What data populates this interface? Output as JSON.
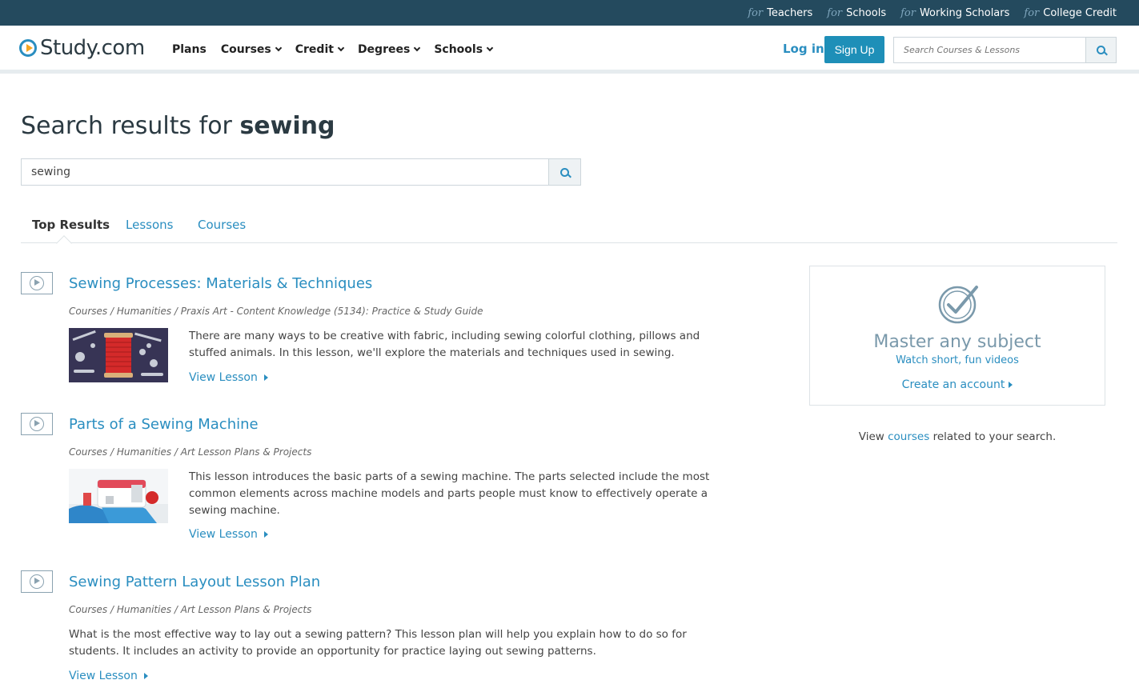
{
  "topbar": {
    "prefix": "for",
    "links": [
      "Teachers",
      "Schools",
      "Working Scholars",
      "College Credit"
    ]
  },
  "header": {
    "logo_text": "Study.com",
    "nav": [
      "Plans",
      "Courses",
      "Credit",
      "Degrees",
      "Schools"
    ],
    "login": "Log in",
    "signup": "Sign Up",
    "search_placeholder": "Search Courses & Lessons"
  },
  "search": {
    "title_prefix": "Search results for",
    "query": "sewing",
    "input_value": "sewing"
  },
  "tabs": [
    "Top Results",
    "Lessons",
    "Courses"
  ],
  "results": [
    {
      "title": "Sewing Processes: Materials & Techniques",
      "breadcrumb": "Courses / Humanities / Praxis Art - Content Knowledge (5134): Practice & Study Guide",
      "description": "There are many ways to be creative with fabric, including sewing colorful clothing, pillows and stuffed animals. In this lesson, we'll explore the materials and techniques used in sewing.",
      "link": "View Lesson"
    },
    {
      "title": "Parts of a Sewing Machine",
      "breadcrumb": "Courses / Humanities / Art Lesson Plans & Projects",
      "description": "This lesson introduces the basic parts of a sewing machine. The parts selected include the most common elements across machine models and parts people must know to effectively operate a sewing machine.",
      "link": "View Lesson"
    },
    {
      "title": "Sewing Pattern Layout Lesson Plan",
      "breadcrumb": "Courses / Humanities / Art Lesson Plans & Projects",
      "description": "What is the most effective way to lay out a sewing pattern? This lesson plan will help you explain how to do so for students. It includes an activity to provide an opportunity for practice laying out sewing patterns.",
      "link": "View Lesson"
    }
  ],
  "promo": {
    "headline": "Master any subject",
    "subline": "Watch short, fun videos",
    "cta": "Create an account"
  },
  "related": {
    "before": "View",
    "link": "courses",
    "after": "related to your search."
  },
  "colors": {
    "topbar": "#244a5e",
    "accent": "#2a8ec0",
    "signup": "#1e8fb8"
  }
}
